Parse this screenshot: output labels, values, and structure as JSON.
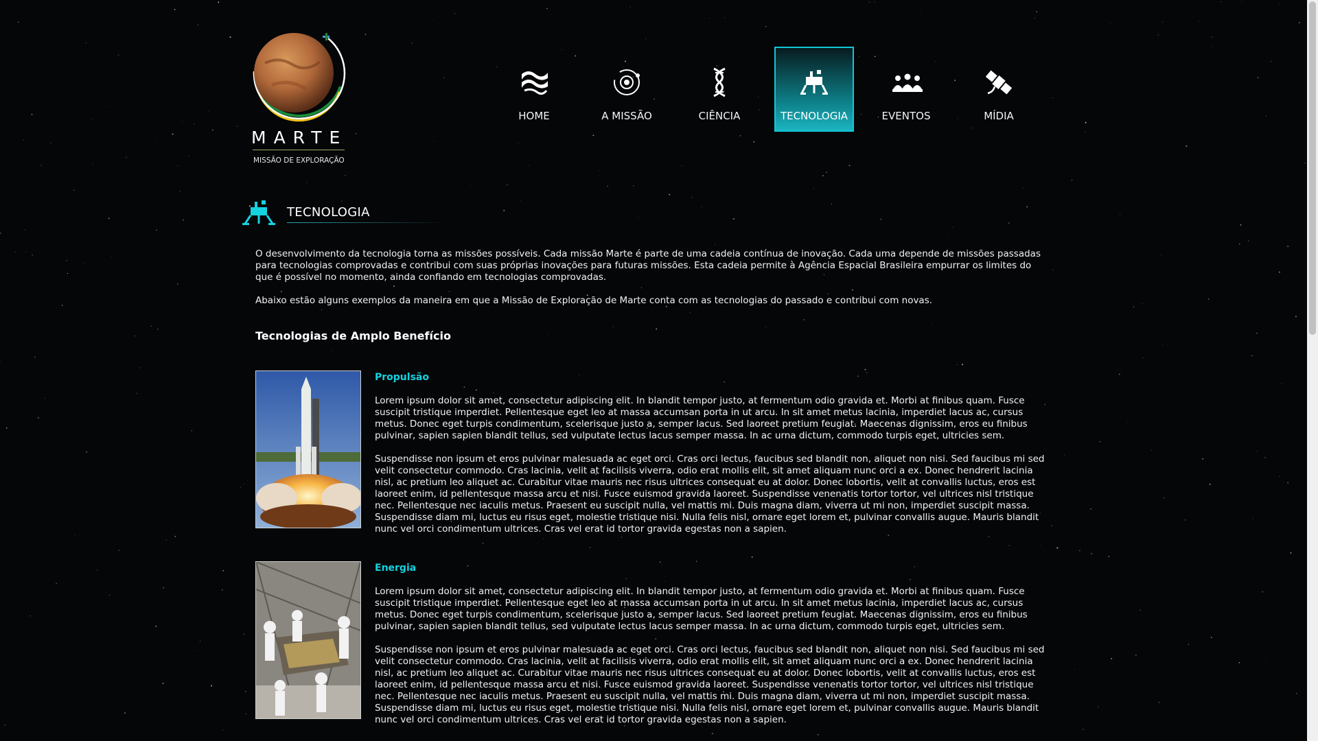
{
  "site": {
    "logo_text": "MARTE",
    "logo_subtitle": "MISSÃO DE EXPLORAÇÃO"
  },
  "nav": [
    {
      "label": "HOME",
      "icon": "waves-icon",
      "active": false
    },
    {
      "label": "A MISSÃO",
      "icon": "orbit-icon",
      "active": false
    },
    {
      "label": "CIÊNCIA",
      "icon": "dna-icon",
      "active": false
    },
    {
      "label": "TECNOLOGIA",
      "icon": "lander-icon",
      "active": true
    },
    {
      "label": "EVENTOS",
      "icon": "people-icon",
      "active": false
    },
    {
      "label": "MÍDIA",
      "icon": "satellite-icon",
      "active": false
    }
  ],
  "section": {
    "title": "TECNOLOGIA",
    "intro_1": "O desenvolvimento da tecnologia torna as missões possíveis. Cada missão Marte é parte de uma cadeia contínua de inovação. Cada uma depende de missões passadas para tecnologias comprovadas e contribui com suas próprias inovações para futuras missões. Esta cadeia permite à Agência Espacial Brasileira empurrar os limites do que é possível no momento, ainda confiando em tecnologias comprovadas.",
    "intro_2": "Abaixo estão alguns exemplos da maneira em que a Missão de Exploração de Marte conta com as tecnologias do passado e contribui com novas.",
    "subheading": "Tecnologias de Amplo Benefício"
  },
  "technologies": [
    {
      "title": "Propulsão",
      "image": "rocket-launch-photo",
      "p1": "Lorem ipsum dolor sit amet, consectetur adipiscing elit. In blandit tempor justo, at fermentum odio gravida et. Morbi at finibus quam. Fusce suscipit tristique imperdiet. Pellentesque eget leo at massa accumsan porta in ut arcu. In sit amet metus lacinia, imperdiet lacus ac, cursus metus. Donec eget turpis condimentum, scelerisque justo a, semper lacus. Sed laoreet pretium feugiat. Maecenas dignissim, eros eu finibus pulvinar, sapien sapien blandit tellus, sed vulputate lectus lacus semper massa. In ac urna dictum, commodo turpis eget, ultricies sem.",
      "p2": "Suspendisse non ipsum et eros pulvinar malesuada ac eget orci. Cras orci lectus, faucibus sed blandit non, aliquet non nisi. Sed faucibus mi sed velit consectetur commodo. Cras lacinia, velit at facilisis viverra, odio erat mollis elit, sit amet aliquam nunc orci a ex. Donec hendrerit lacinia nisl, ac pretium leo aliquet ac. Curabitur vitae mauris nec risus ultrices consequat eu at dolor. Donec lobortis, velit at convallis luctus, eros est laoreet enim, id pellentesque massa arcu et nisi. Fusce euismod gravida laoreet. Suspendisse venenatis tortor tortor, vel ultrices nisl tristique nec. Pellentesque nec iaculis metus. Praesent eu suscipit nulla, vel mattis mi. Duis magna diam, viverra ut mi non, imperdiet suscipit massa. Suspendisse diam mi, luctus eu risus eget, molestie tristique nisi. Nulla felis nisl, ornare eget lorem et, pulvinar convallis augue. Mauris blandit nunc vel orci condimentum ultrices. Cras vel erat id tortor gravida egestas non a sapien."
    },
    {
      "title": "Energia",
      "image": "clean-room-spacecraft-photo",
      "p1": "Lorem ipsum dolor sit amet, consectetur adipiscing elit. In blandit tempor justo, at fermentum odio gravida et. Morbi at finibus quam. Fusce suscipit tristique imperdiet. Pellentesque eget leo at massa accumsan porta in ut arcu. In sit amet metus lacinia, imperdiet lacus ac, cursus metus. Donec eget turpis condimentum, scelerisque justo a, semper lacus. Sed laoreet pretium feugiat. Maecenas dignissim, eros eu finibus pulvinar, sapien sapien blandit tellus, sed vulputate lectus lacus semper massa. In ac urna dictum, commodo turpis eget, ultricies sem.",
      "p2": "Suspendisse non ipsum et eros pulvinar malesuada ac eget orci. Cras orci lectus, faucibus sed blandit non, aliquet non nisi. Sed faucibus mi sed velit consectetur commodo. Cras lacinia, velit at facilisis viverra, odio erat mollis elit, sit amet aliquam nunc orci a ex. Donec hendrerit lacinia nisl, ac pretium leo aliquet ac. Curabitur vitae mauris nec risus ultrices consequat eu at dolor. Donec lobortis, velit at convallis luctus, eros est laoreet enim, id pellentesque massa arcu et nisi. Fusce euismod gravida laoreet. Suspendisse venenatis tortor tortor, vel ultrices nisl tristique nec. Pellentesque nec iaculis metus. Praesent eu suscipit nulla, vel mattis mi. Duis magna diam, viverra ut mi non, imperdiet suscipit massa. Suspendisse diam mi, luctus eu risus eget, molestie tristique nisi. Nulla felis nisl, ornare eget lorem et, pulvinar convallis augue. Mauris blandit nunc vel orci condimentum ultrices. Cras vel erat id tortor gravida egestas non a sapien."
    }
  ],
  "colors": {
    "accent": "#14d2e0",
    "background": "#050608",
    "text": "#f2f2f2"
  }
}
